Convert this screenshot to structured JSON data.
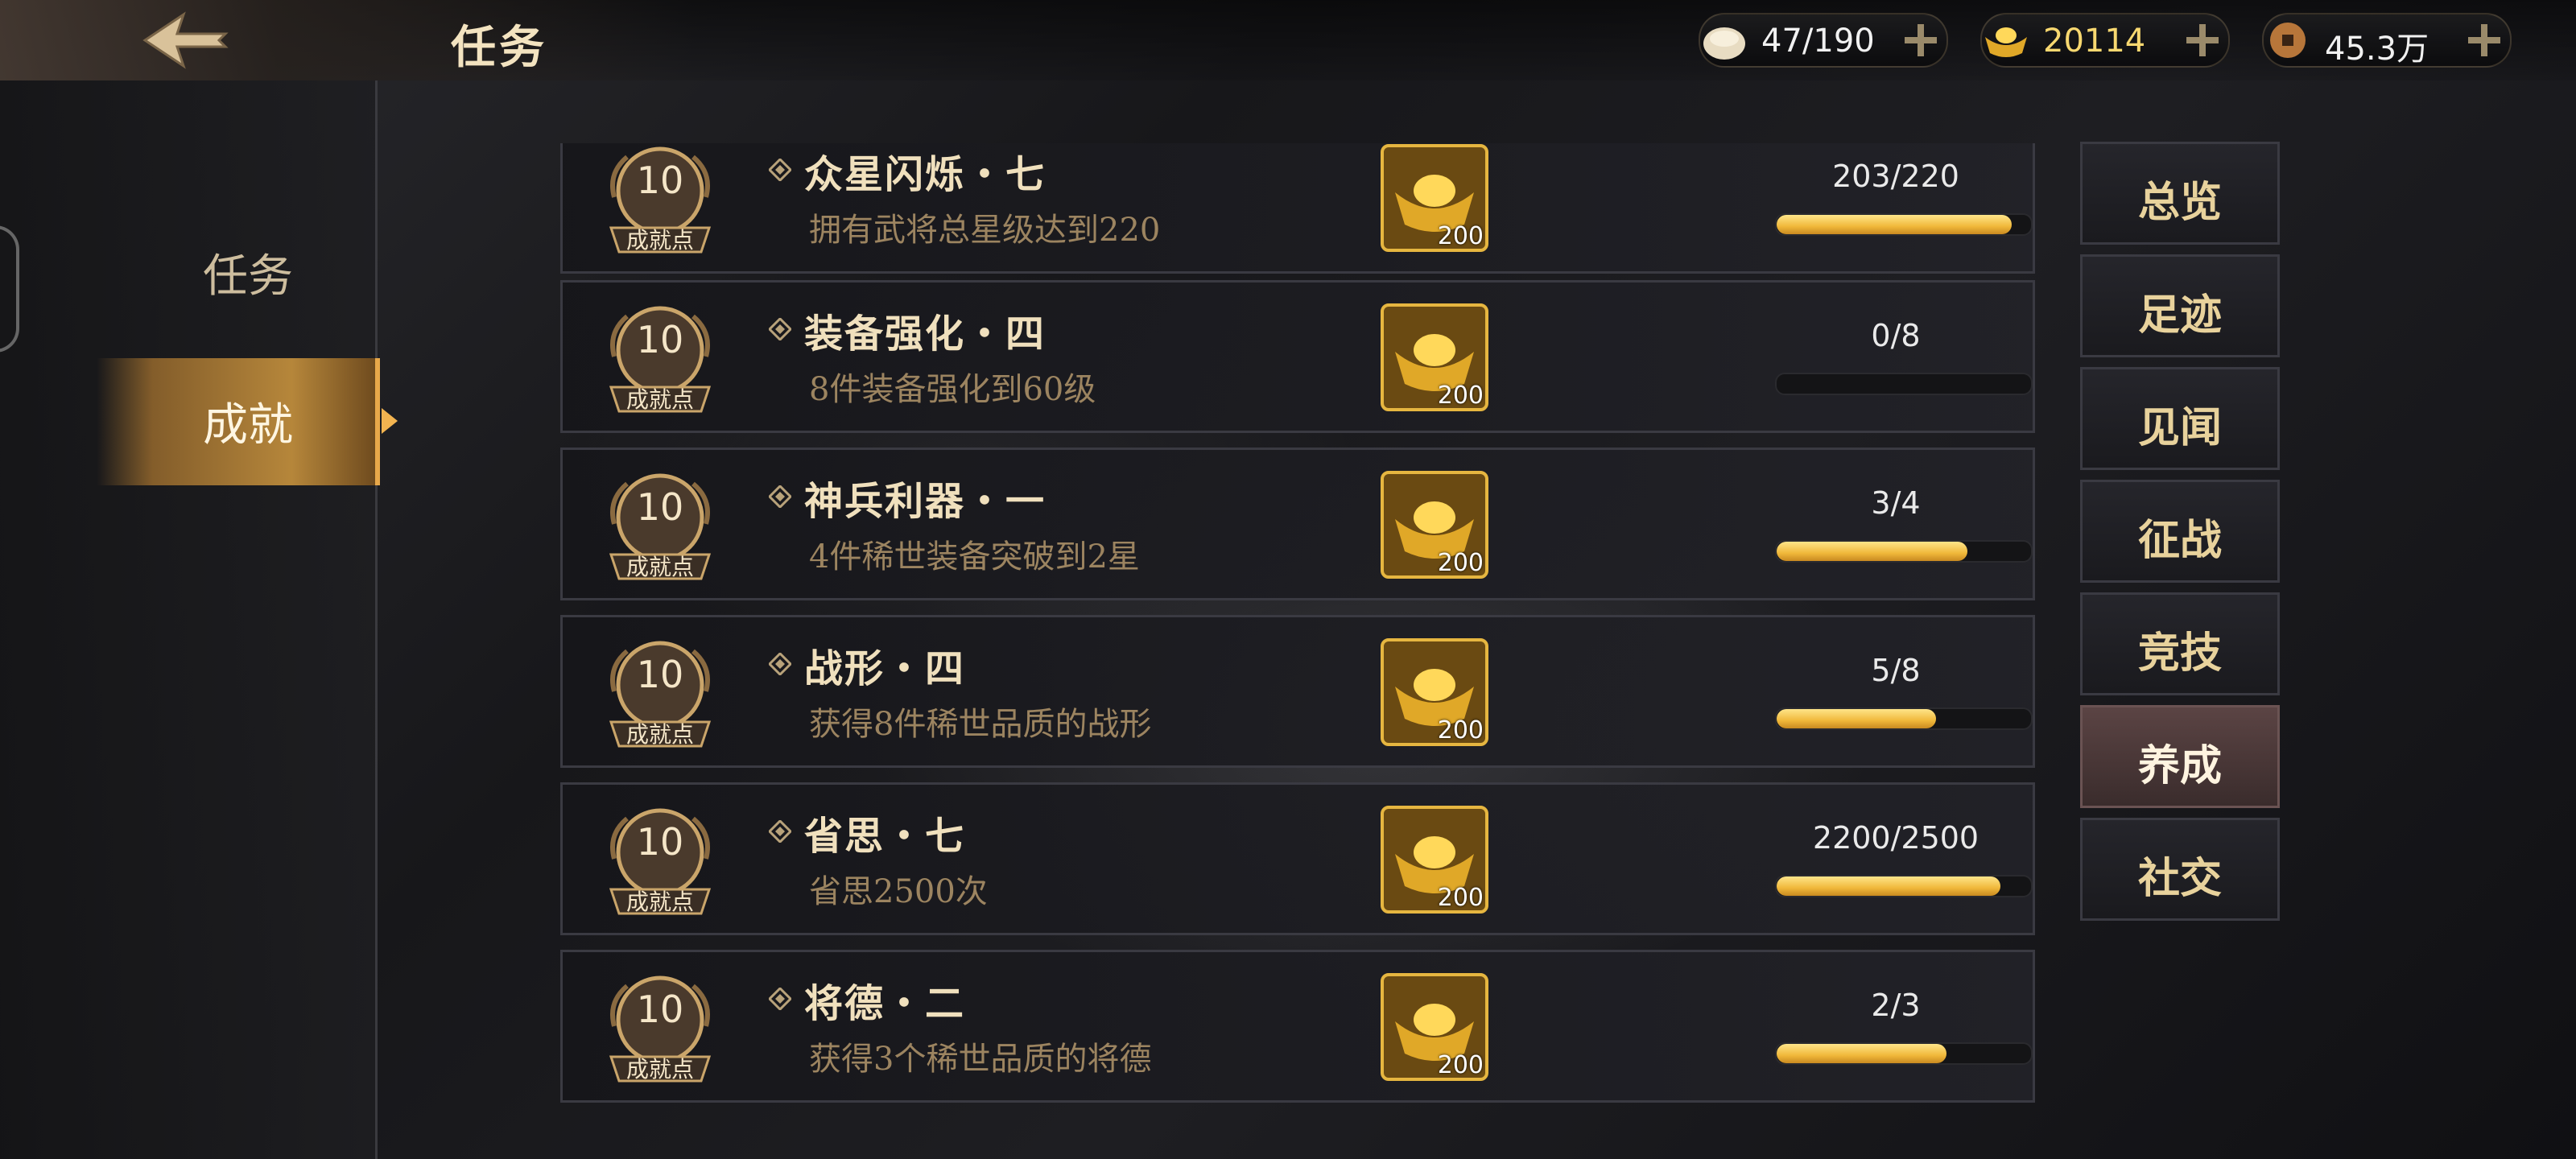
{
  "header": {
    "title": "任务",
    "currencies": [
      {
        "name": "stamina",
        "value": "47/190",
        "icon": "steamed-bun-icon"
      },
      {
        "name": "gold-ingot",
        "value": "20114",
        "icon": "gold-ingot-icon"
      },
      {
        "name": "copper-coin",
        "value": "45.3万",
        "icon": "coin-icon"
      }
    ]
  },
  "left_nav": {
    "items": [
      {
        "label": "任务",
        "active": false
      },
      {
        "label": "成就",
        "active": true
      }
    ]
  },
  "achievements": [
    {
      "points": "10",
      "points_label": "成就点",
      "name": "众星闪烁・七",
      "desc": "拥有武将总星级达到220",
      "reward_count": "200",
      "progress_text": "203/220",
      "progress": 0.923
    },
    {
      "points": "10",
      "points_label": "成就点",
      "name": "装备强化・四",
      "desc": "8件装备强化到60级",
      "reward_count": "200",
      "progress_text": "0/8",
      "progress": 0
    },
    {
      "points": "10",
      "points_label": "成就点",
      "name": "神兵利器・一",
      "desc": "4件稀世装备突破到2星",
      "reward_count": "200",
      "progress_text": "3/4",
      "progress": 0.75
    },
    {
      "points": "10",
      "points_label": "成就点",
      "name": "战形・四",
      "desc": "获得8件稀世品质的战形",
      "reward_count": "200",
      "progress_text": "5/8",
      "progress": 0.625
    },
    {
      "points": "10",
      "points_label": "成就点",
      "name": "省思・七",
      "desc": "省思2500次",
      "reward_count": "200",
      "progress_text": "2200/2500",
      "progress": 0.88
    },
    {
      "points": "10",
      "points_label": "成就点",
      "name": "将德・二",
      "desc": "获得3个稀世品质的将德",
      "reward_count": "200",
      "progress_text": "2/3",
      "progress": 0.667
    }
  ],
  "categories": [
    {
      "label": "总览",
      "active": false
    },
    {
      "label": "足迹",
      "active": false
    },
    {
      "label": "见闻",
      "active": false
    },
    {
      "label": "征战",
      "active": false
    },
    {
      "label": "竞技",
      "active": false
    },
    {
      "label": "养成",
      "active": true
    },
    {
      "label": "社交",
      "active": false
    }
  ],
  "colors": {
    "accent_gold": "#f0b83a",
    "active_category": "#5b4444",
    "text_gold": "#e8d29c"
  }
}
